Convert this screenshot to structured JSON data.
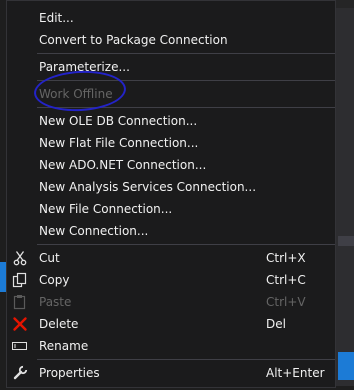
{
  "menu": {
    "edit": "Edit...",
    "convert": "Convert to Package Connection",
    "parameterize": "Parameterize...",
    "work_offline": "Work Offline",
    "new_oledb": "New OLE DB Connection...",
    "new_flatfile": "New Flat File Connection...",
    "new_adonet": "New ADO.NET Connection...",
    "new_analysis": "New Analysis Services Connection...",
    "new_file": "New File Connection...",
    "new_connection": "New Connection...",
    "cut": {
      "label": "Cut",
      "shortcut": "Ctrl+X"
    },
    "copy": {
      "label": "Copy",
      "shortcut": "Ctrl+C"
    },
    "paste": {
      "label": "Paste",
      "shortcut": "Ctrl+V"
    },
    "delete": {
      "label": "Delete",
      "shortcut": "Del"
    },
    "rename": {
      "label": "Rename"
    },
    "properties": {
      "label": "Properties",
      "shortcut": "Alt+Enter"
    }
  },
  "colors": {
    "menu_bg": "#1b1b1c",
    "text": "#f1f1f1",
    "disabled_text": "#656565",
    "delete_icon": "#e51400",
    "annotation_circle": "#2323c8"
  },
  "icons": {
    "cut": "scissors-icon",
    "copy": "copy-icon",
    "paste": "paste-icon",
    "delete": "delete-x-icon",
    "rename": "rename-icon",
    "properties": "wrench-icon"
  }
}
